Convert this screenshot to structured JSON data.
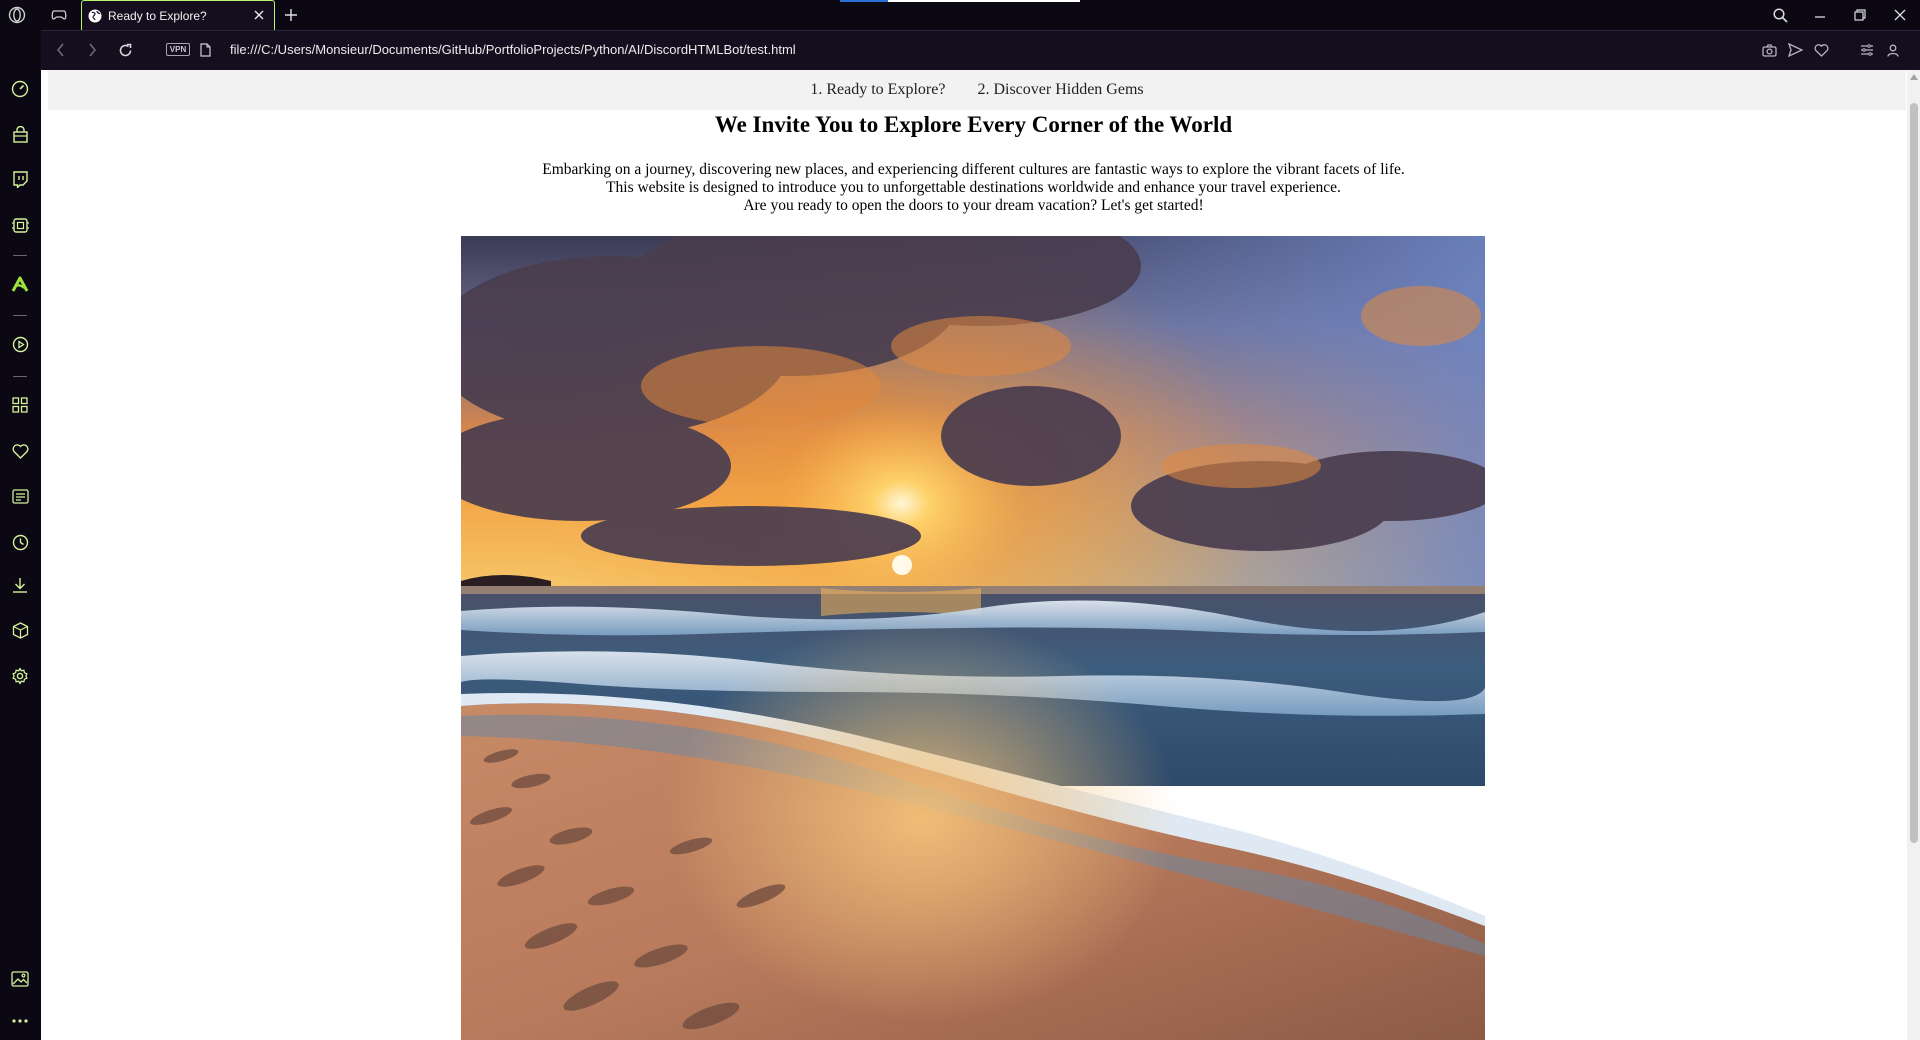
{
  "browser": {
    "tab": {
      "title": "Ready to Explore?"
    },
    "address": {
      "vpn_label": "VPN",
      "url": "file:///C:/Users/Monsieur/Documents/GitHub/PortfolioProjects/Python/AI/DiscordHTMLBot/test.html"
    },
    "titlebar_icons": [
      "opera-logo-icon",
      "gaming-controller-icon",
      "new-tab-icon",
      "search-icon",
      "minimize-icon",
      "restore-icon",
      "close-icon"
    ],
    "address_icons": [
      "back-icon",
      "forward-icon",
      "reload-icon",
      "page-icon",
      "snapshot-icon",
      "send-icon",
      "heart-icon",
      "easy-setup-icon",
      "profile-icon"
    ],
    "sidebar_icons": [
      "speed-dial-icon",
      "shopping-bag-icon",
      "twitch-icon",
      "aria-icon",
      "vector-icon",
      "player-icon",
      "workspaces-icon",
      "bookmarks-icon",
      "news-icon",
      "history-icon",
      "downloads-icon",
      "extensions-icon",
      "settings-icon",
      "image-icon",
      "more-icon"
    ],
    "accent_color": "#b7f36b"
  },
  "page": {
    "nav": [
      "1. Ready to Explore?",
      "2. Discover Hidden Gems"
    ],
    "heading": "We Invite You to Explore Every Corner of the World",
    "intro": [
      "Embarking on a journey, discovering new places, and experiencing different cultures are fantastic ways to explore the vibrant facets of life.",
      "This website is designed to introduce you to unforgettable destinations worldwide and enhance your travel experience.",
      "Are you ready to open the doors to your dream vacation? Let's get started!"
    ],
    "hero_image": "sunset over ocean waves on a sandy beach with footprints"
  }
}
